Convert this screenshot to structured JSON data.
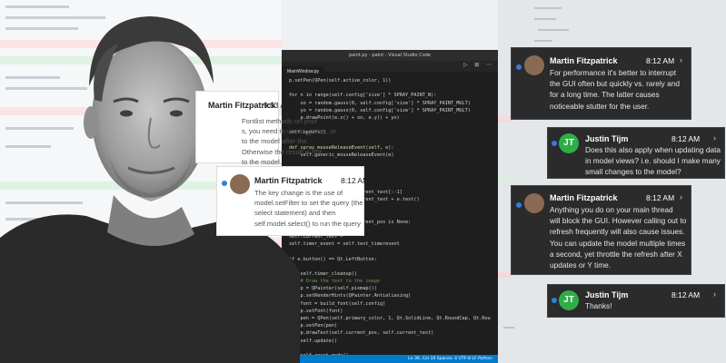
{
  "editor": {
    "title": "paint.py - paint - Visual Studio Code",
    "tab": "MainWindow.py",
    "tab_icons": "▷ ⊞ ⋯",
    "status": "Ln 36, Col 10   Spaces: 4   UTF-8   LF   Python",
    "code_lines": [
      "p.setPen(QPen(self.active_color, 1))",
      "",
      "for n in range(self.config['size'] * SPRAY_PAINT_N):",
      "    xo = random.gauss(0, self.config['size'] * SPRAY_PAINT_MULT)",
      "    yo = random.gauss(0, self.config['size'] * SPRAY_PAINT_MULT)",
      "    p.drawPoint(e.x() + xo, e.y() + yo)",
      "",
      "self.update()",
      "",
      "def spray_mouseReleaseEvent(self, e):",
      "    self.generic_mouseReleaseEvent(e)",
      "",
      "",
      "",
      "",
      "                  self.current_text[:-1]",
      "                  self.current_text + e.text()",
      "",
      "",
      "                  self.current_pos is None:",
      "",
      "self.current_text = \"\"",
      "self.timer_event = self.text_timerevent",
      "",
      "if e.button() == Qt.LeftButton:",
      "",
      "    self.timer_cleanup()",
      "    # Draw the text to the image",
      "    p = QPainter(self.pixmap())",
      "    p.setRenderHints(QPainter.Antialiasing)",
      "    font = build_font(self.config)",
      "    p.setFont(font)",
      "    pen = QPen(self.primary_color, 1, Qt.SolidLine, Qt.RoundCap, Qt.Rou",
      "    p.setPen(pen)",
      "    p.drawText(self.current_pos, self.current_text)",
      "    self.update()",
      "",
      "    self.reset_mode()"
    ]
  },
  "toasts_light": [
    {
      "name": "Martin Fitzpatrick",
      "time": "9:53 AM",
      "lines": [
        "Fontlist methods on your",
        "s, you need to use m_place, or",
        "to the model after the",
        "Otherwise the result is not",
        "to the model."
      ]
    },
    {
      "name": "Martin Fitzpatrick",
      "time": "8:12 AM",
      "lines": [
        "The key change is the use of",
        "model.setFilter to set the query (the",
        "select statement) and then",
        "self.model.select() to run the query"
      ]
    }
  ],
  "toasts_dark": [
    {
      "name": "Martin Fitzpatrick",
      "time": "8:12 AM",
      "lines": [
        "For performance it's better to interrupt",
        "the GUI often but quickly vs. rarely and",
        "for a long time. The latter causes",
        "noticeable stutter for the user."
      ]
    },
    {
      "name": "Justin Tijm",
      "initials": "JT",
      "time": "8:12 AM",
      "lines": [
        "Does this also apply when updating data",
        "in model views? i.e. should I make many",
        "small changes to the model?"
      ]
    },
    {
      "name": "Martin Fitzpatrick",
      "time": "8:12 AM",
      "lines": [
        "Anything you do on your main thread",
        "will block the GUI. However calling out to",
        "refresh frequently will also cause issues.",
        "You can update the model multiple times",
        "a second, yet throttle the refresh after X",
        "updates or Y time."
      ]
    },
    {
      "name": "Justin Tijm",
      "initials": "JT",
      "time": "8:12 AM",
      "lines": [
        "Thanks!"
      ]
    }
  ],
  "icons": {
    "chevron": "chevron-right-icon",
    "unread": "unread-dot-icon"
  },
  "colors": {
    "accent_blue": "#2f7fe0",
    "jt_green": "#2fae47",
    "toast_dark": "#2b2b2b",
    "statusbar": "#007acc"
  }
}
